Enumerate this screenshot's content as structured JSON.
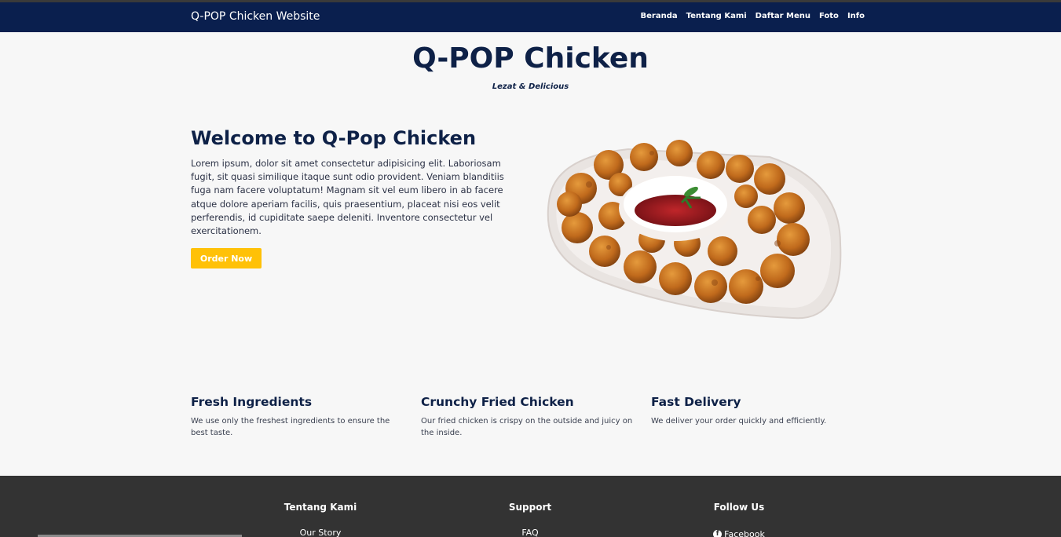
{
  "navbar": {
    "brand": "Q-POP Chicken Website",
    "links": [
      "Beranda",
      "Tentang Kami",
      "Daftar Menu",
      "Foto",
      "Info"
    ]
  },
  "hero": {
    "title": "Q-POP Chicken",
    "tagline": "Lezat & Delicious"
  },
  "welcome": {
    "title": "Welcome to Q-Pop Chicken",
    "text": "Lorem ipsum, dolor sit amet consectetur adipisicing elit. Laboriosam fugit, sit quasi similique itaque sunt odio provident. Veniam blanditiis fuga nam facere voluptatum! Magnam sit vel eum libero in ab facere atque dolore aperiam facilis, quis praesentium, placeat nisi eos velit perferendis, id cupiditate saepe deleniti. Inventore consectetur vel exercitationem.",
    "button": "Order Now"
  },
  "features": [
    {
      "title": "Fresh Ingredients",
      "text": "We use only the freshest ingredients to ensure the best taste."
    },
    {
      "title": "Crunchy Fried Chicken",
      "text": "Our fried chicken is crispy on the outside and juicy on the inside."
    },
    {
      "title": "Fast Delivery",
      "text": "We deliver your order quickly and efficiently."
    }
  ],
  "footer": {
    "columns": [
      {
        "title": "Tentang Kami",
        "link": "Our Story"
      },
      {
        "title": "Support",
        "link": "FAQ"
      },
      {
        "title": "Follow Us",
        "link": "Facebook",
        "icon": "facebook-icon"
      }
    ]
  },
  "colors": {
    "navbar": "#0a1f4e",
    "accent": "#ffc107",
    "footer": "#333333"
  }
}
